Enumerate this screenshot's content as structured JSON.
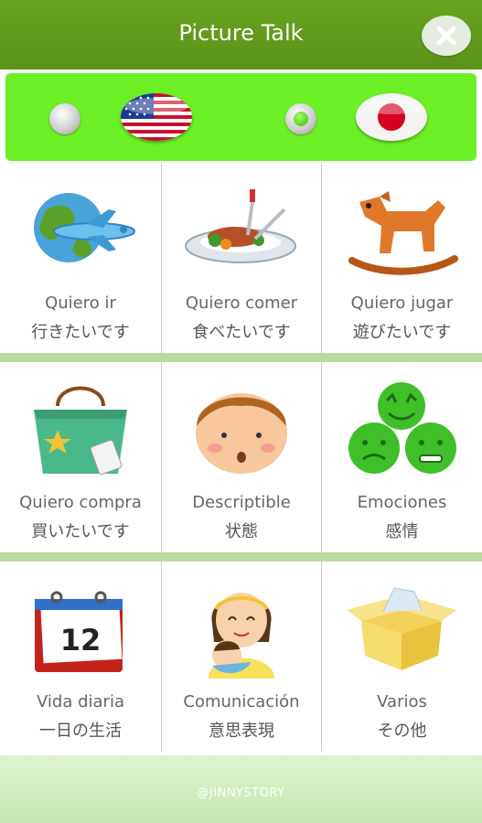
{
  "header": {
    "title": "Picture Talk"
  },
  "language_bar": {
    "options": [
      {
        "language": "English",
        "flag": "us-flag-icon",
        "selected": false
      },
      {
        "language": "Japanese",
        "flag": "japan-flag-icon",
        "selected": true
      }
    ]
  },
  "categories": [
    {
      "es": "Quiero ir",
      "ja": "行きたいです",
      "icon": "globe-airplane-icon"
    },
    {
      "es": "Quiero comer",
      "ja": "食べたいです",
      "icon": "food-plate-icon"
    },
    {
      "es": "Quiero jugar",
      "ja": "遊びたいです",
      "icon": "rocking-horse-icon"
    },
    {
      "es": "Quiero compra",
      "ja": "買いたいです",
      "icon": "shopping-bag-icon"
    },
    {
      "es": "Descriptible",
      "ja": "状態",
      "icon": "boy-face-icon"
    },
    {
      "es": "Emociones",
      "ja": "感情",
      "icon": "emotion-smileys-icon"
    },
    {
      "es": "Vida diaria",
      "ja": "一日の生活",
      "icon": "calendar-icon"
    },
    {
      "es": "Comunicación",
      "ja": "意思表現",
      "icon": "mother-baby-icon"
    },
    {
      "es": "Varios",
      "ja": "その他",
      "icon": "open-box-icon"
    }
  ],
  "calendar_icon_text": "12",
  "footer": {
    "credit": "@JINNYSTORY"
  },
  "colors": {
    "title_bar": "#5f991b",
    "language_bar": "#6cf025",
    "separator": "#b9dba0"
  }
}
